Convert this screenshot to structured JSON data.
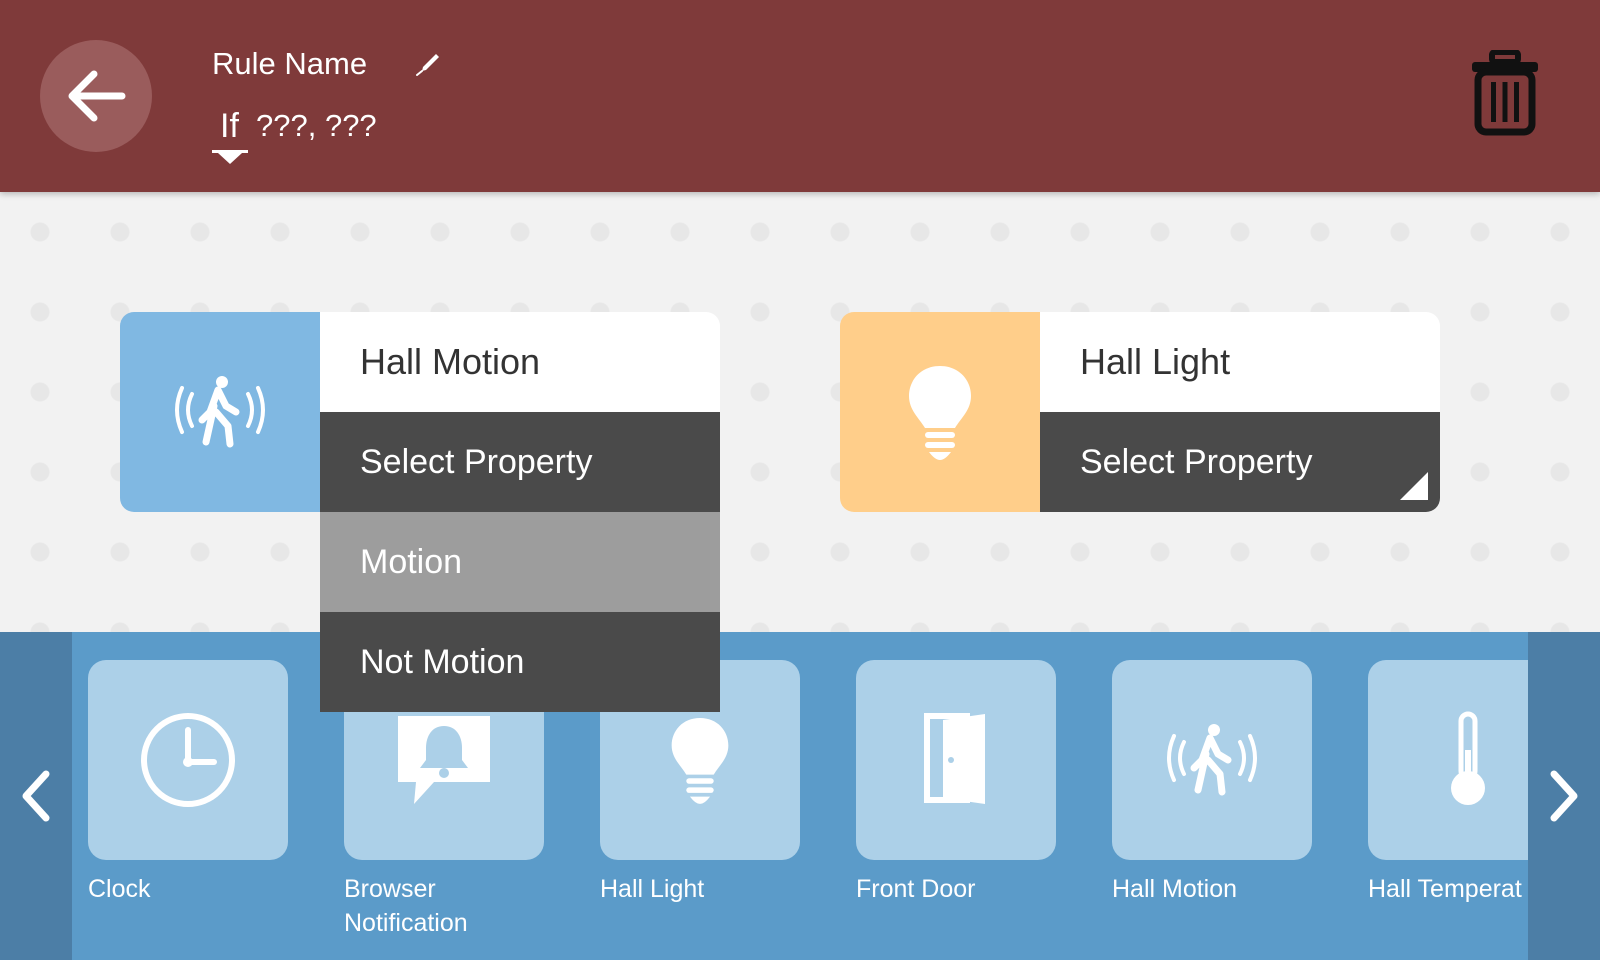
{
  "header": {
    "rule_name": "Rule Name",
    "trigger_keyword": "If",
    "rule_summary": "???, ???"
  },
  "blocks": [
    {
      "device_name": "Hall Motion",
      "select_label": "Select Property",
      "icon": "motion-sensor-icon",
      "color": "#80b8e2",
      "options": [
        "Motion",
        "Not Motion"
      ],
      "highlighted_option": "Motion"
    },
    {
      "device_name": "Hall Light",
      "select_label": "Select Property",
      "icon": "light-bulb-icon",
      "color": "#ffce8a"
    }
  ],
  "palette": {
    "items": [
      {
        "label": "Clock",
        "icon": "clock-icon"
      },
      {
        "label": "Browser Notification",
        "icon": "notification-bell-icon"
      },
      {
        "label": "Hall Light",
        "icon": "light-bulb-icon"
      },
      {
        "label": "Front Door",
        "icon": "door-icon"
      },
      {
        "label": "Hall Motion",
        "icon": "motion-sensor-icon"
      },
      {
        "label": "Hall Temperat",
        "icon": "thermometer-icon"
      }
    ]
  },
  "colors": {
    "header": "#7f3a3a",
    "palette": "#5b9bc9",
    "tile": "#acd0e8",
    "select": "#4a4a4a",
    "highlight": "#9d9d9d"
  }
}
